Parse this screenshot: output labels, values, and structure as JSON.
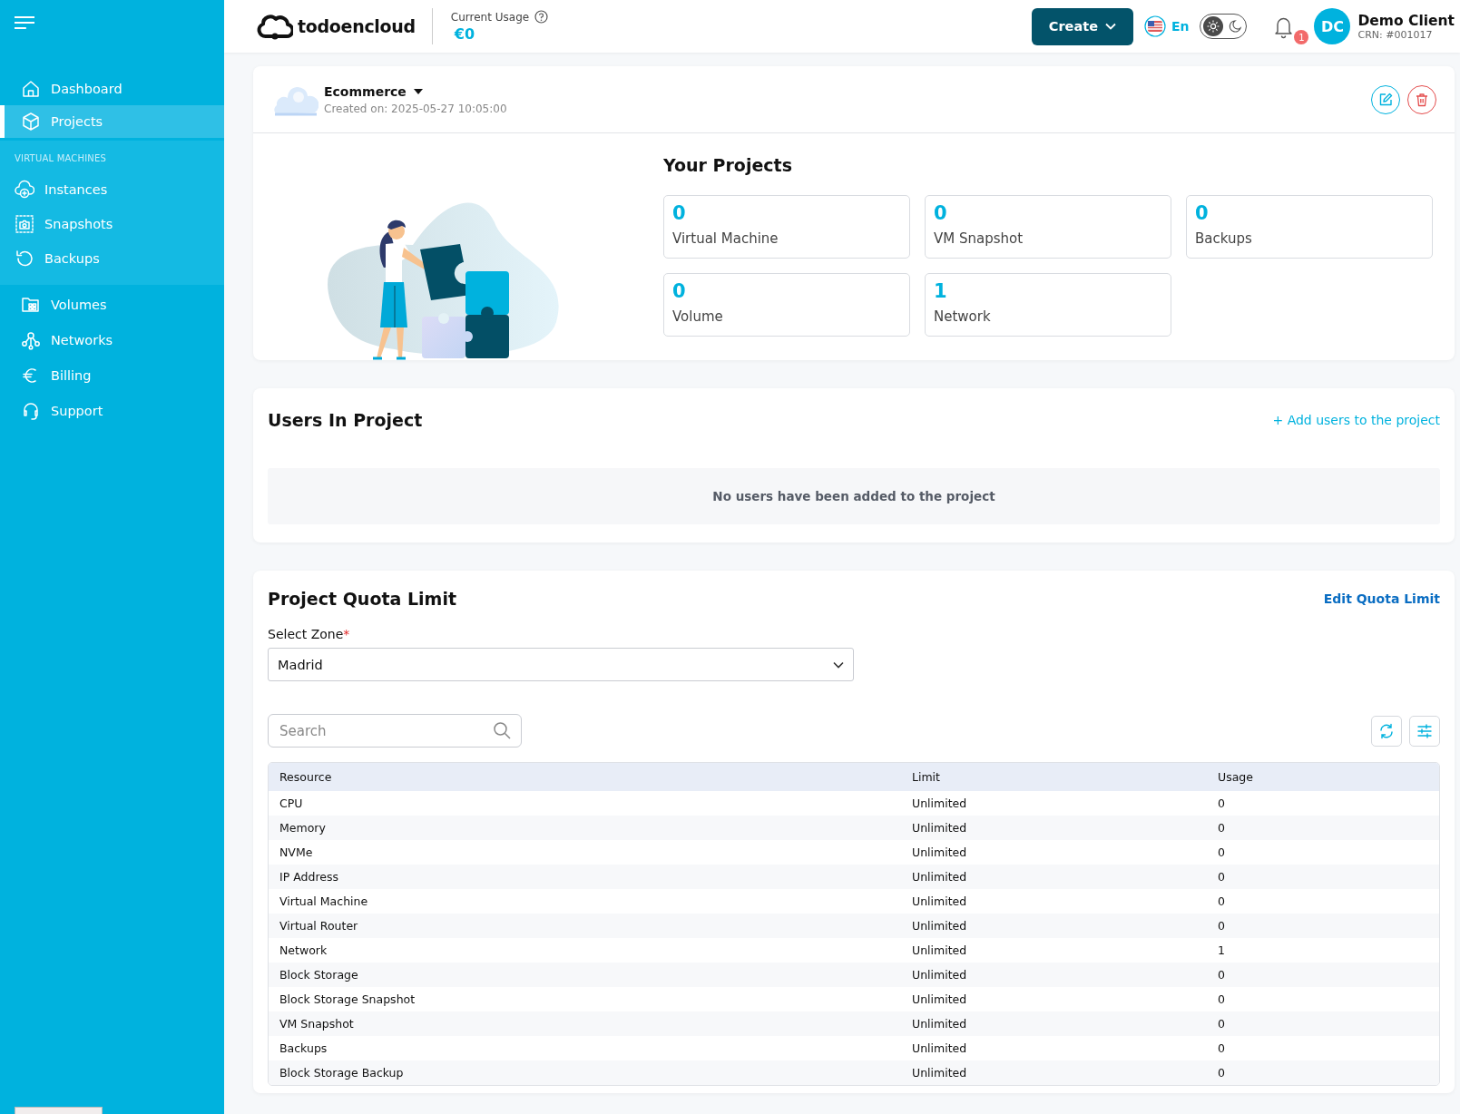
{
  "header": {
    "logo": "todoencloud",
    "usage": {
      "label": "Current Usage",
      "value": "€0"
    },
    "create_button": "Create",
    "language": "En",
    "theme_toggle": {
      "dark": false
    },
    "notifications": {
      "count": "1"
    },
    "user": {
      "initials": "DC",
      "name": "Demo Client",
      "crn": "CRN: #001017"
    }
  },
  "sidebar": {
    "items": [
      {
        "label": "Dashboard",
        "selected": false
      },
      {
        "label": "Projects",
        "selected": true
      }
    ],
    "section": {
      "heading": "VIRTUAL MACHINES",
      "items": [
        {
          "label": "Instances",
          "selected": false
        },
        {
          "label": "Snapshots",
          "selected": false
        },
        {
          "label": "Backups",
          "selected": false
        }
      ]
    },
    "more_items": [
      {
        "label": "Volumes",
        "selected": false
      },
      {
        "label": "Networks",
        "selected": false
      },
      {
        "label": "Billing",
        "selected": false
      },
      {
        "label": "Support",
        "selected": false
      }
    ]
  },
  "project": {
    "name": "Ecommerce",
    "created": "Created on: 2025-05-27 10:05:00",
    "heading": "Your Projects",
    "stats": [
      {
        "value": "0",
        "label": "Virtual Machine"
      },
      {
        "value": "0",
        "label": "VM Snapshot"
      },
      {
        "value": "0",
        "label": "Backups"
      },
      {
        "value": "0",
        "label": "Volume"
      },
      {
        "value": "1",
        "label": "Network"
      }
    ]
  },
  "users": {
    "title": "Users In Project",
    "add_link": "+ Add users to the project",
    "empty_message": "No users have been added to the project"
  },
  "quota": {
    "title": "Project Quota Limit",
    "edit_link": "Edit Quota Limit",
    "zone": {
      "label": "Select Zone",
      "required_mark": "*",
      "value": "Madrid"
    },
    "search": {
      "placeholder": "Search"
    },
    "table": {
      "columns": [
        "Resource",
        "Limit",
        "Usage"
      ],
      "rows": [
        [
          "CPU",
          "Unlimited",
          "0"
        ],
        [
          "Memory",
          "Unlimited",
          "0"
        ],
        [
          "NVMe",
          "Unlimited",
          "0"
        ],
        [
          "IP Address",
          "Unlimited",
          "0"
        ],
        [
          "Virtual Machine",
          "Unlimited",
          "0"
        ],
        [
          "Virtual Router",
          "Unlimited",
          "0"
        ],
        [
          "Network",
          "Unlimited",
          "1"
        ],
        [
          "Block Storage",
          "Unlimited",
          "0"
        ],
        [
          "Block Storage Snapshot",
          "Unlimited",
          "0"
        ],
        [
          "VM Snapshot",
          "Unlimited",
          "0"
        ],
        [
          "Backups",
          "Unlimited",
          "0"
        ],
        [
          "Block Storage Backup",
          "Unlimited",
          "0"
        ]
      ]
    }
  }
}
